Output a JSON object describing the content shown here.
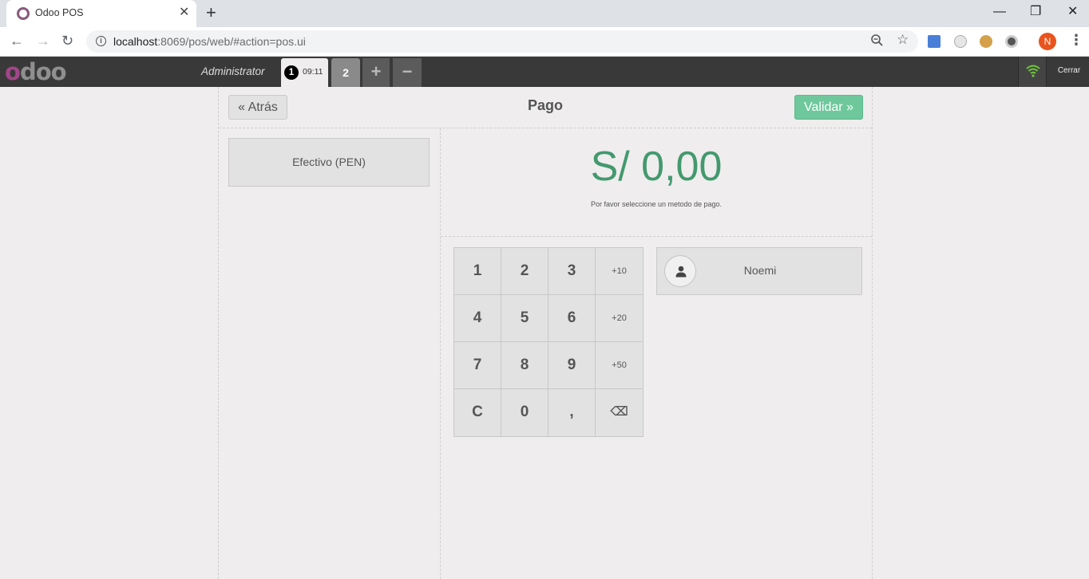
{
  "browser": {
    "tab_title": "Odoo POS",
    "url_host": "localhost",
    "url_path": ":8069/pos/web/#action=pos.ui",
    "profile_initial": "N"
  },
  "pos_header": {
    "cashier": "Administrator",
    "orders": [
      {
        "number": "1",
        "time": "09:11",
        "selected": true
      },
      {
        "number": "2",
        "selected": false
      }
    ],
    "add_order_label": "+",
    "delete_order_label": "−",
    "close_label": "Cerrar"
  },
  "payment": {
    "back_label": "Atrás",
    "title": "Pago",
    "validate_label": "Validar",
    "payment_method": "Efectivo (PEN)",
    "total": "S/ 0,00",
    "help_text": "Por favor seleccione un metodo de pago.",
    "customer_name": "Noemi",
    "numpad": [
      [
        "1",
        "2",
        "3",
        "+10"
      ],
      [
        "4",
        "5",
        "6",
        "+20"
      ],
      [
        "7",
        "8",
        "9",
        "+50"
      ],
      [
        "C",
        "0",
        ",",
        "⌫"
      ]
    ]
  },
  "colors": {
    "accent_green": "#6ec89b",
    "total_green": "#43996e",
    "odoo_purple": "#a24689",
    "topbar": "#393939"
  }
}
